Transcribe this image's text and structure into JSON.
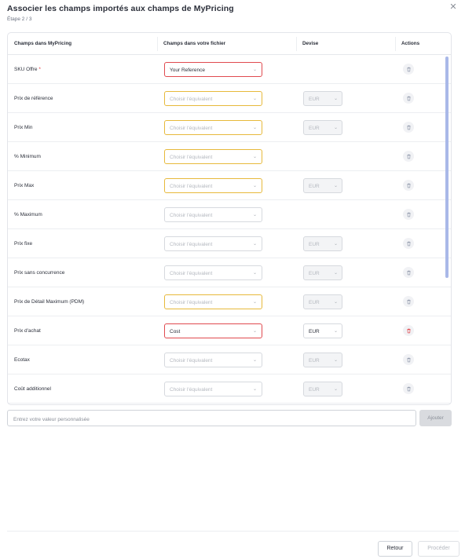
{
  "dialog": {
    "title": "Associer les champs importés aux champs de MyPricing",
    "step": "Étape 2 / 3",
    "close_icon": "close-icon"
  },
  "table": {
    "headers": {
      "field": "Champs dans MyPricing",
      "file": "Champs dans votre fichier",
      "currency": "Devise",
      "actions": "Actions"
    },
    "rows": [
      {
        "label": "SKU Offre",
        "required": "*",
        "value": "Your Reference",
        "placeholder": "",
        "select_state": "error",
        "currency": "",
        "currency_state": "none",
        "trash_color": "#8a93a6"
      },
      {
        "label": "Prix de référence",
        "required": "",
        "value": "",
        "placeholder": "Choisir l'équivalent",
        "select_state": "warning",
        "currency": "EUR",
        "currency_state": "disabled",
        "trash_color": "#8a93a6"
      },
      {
        "label": "Prix Min",
        "required": "",
        "value": "",
        "placeholder": "Choisir l'équivalent",
        "select_state": "warning",
        "currency": "EUR",
        "currency_state": "disabled",
        "trash_color": "#8a93a6"
      },
      {
        "label": "% Minimum",
        "required": "",
        "value": "",
        "placeholder": "Choisir l'équivalent",
        "select_state": "warning",
        "currency": "",
        "currency_state": "none",
        "trash_color": "#8a93a6"
      },
      {
        "label": "Prix Max",
        "required": "",
        "value": "",
        "placeholder": "Choisir l'équivalent",
        "select_state": "warning",
        "currency": "EUR",
        "currency_state": "disabled",
        "trash_color": "#8a93a6"
      },
      {
        "label": "% Maximum",
        "required": "",
        "value": "",
        "placeholder": "Choisir l'équivalent",
        "select_state": "normal",
        "currency": "",
        "currency_state": "none",
        "trash_color": "#8a93a6"
      },
      {
        "label": "Prix fixe",
        "required": "",
        "value": "",
        "placeholder": "Choisir l'équivalent",
        "select_state": "normal",
        "currency": "EUR",
        "currency_state": "disabled",
        "trash_color": "#8a93a6"
      },
      {
        "label": "Prix sans concurrence",
        "required": "",
        "value": "",
        "placeholder": "Choisir l'équivalent",
        "select_state": "normal",
        "currency": "EUR",
        "currency_state": "disabled",
        "trash_color": "#8a93a6"
      },
      {
        "label": "Prix de Détail Maximum (PDM)",
        "required": "",
        "value": "",
        "placeholder": "Choisir l'équivalent",
        "select_state": "warning",
        "currency": "EUR",
        "currency_state": "disabled",
        "trash_color": "#8a93a6"
      },
      {
        "label": "Prix d'achat",
        "required": "",
        "value": "Cost",
        "placeholder": "",
        "select_state": "error",
        "currency": "EUR",
        "currency_state": "active",
        "trash_color": "#e0353b"
      },
      {
        "label": "Ecotax",
        "required": "",
        "value": "",
        "placeholder": "Choisir l'équivalent",
        "select_state": "normal",
        "currency": "EUR",
        "currency_state": "disabled",
        "trash_color": "#8a93a6"
      },
      {
        "label": "Coût additionnel",
        "required": "",
        "value": "",
        "placeholder": "Choisir l'équivalent",
        "select_state": "normal",
        "currency": "EUR",
        "currency_state": "disabled",
        "trash_color": "#8a93a6"
      }
    ]
  },
  "custom": {
    "placeholder": "Entrez votre valeur personnalisée",
    "add_label": "Ajouter"
  },
  "footer": {
    "back_label": "Retour",
    "next_label": "Procéder"
  },
  "colors": {
    "warning_border": "#e7b93b",
    "error_border": "#e04a4f",
    "scroll_thumb": "#a9b8e8"
  }
}
